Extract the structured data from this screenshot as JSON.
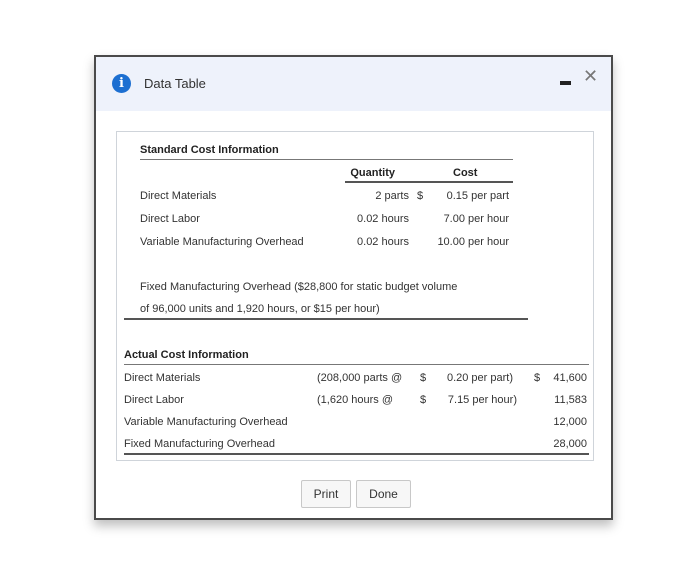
{
  "dialog": {
    "title": "Data Table",
    "info_icon": "i",
    "close_glyph": "✕",
    "buttons": {
      "print": "Print",
      "done": "Done"
    }
  },
  "standard": {
    "heading": "Standard Cost Information",
    "col_quantity": "Quantity",
    "col_cost": "Cost",
    "rows": [
      {
        "label": "Direct Materials",
        "qty": "2 parts",
        "dollar": "$",
        "cost": "0.15 per part"
      },
      {
        "label": "Direct Labor",
        "qty": "0.02 hours",
        "dollar": "",
        "cost": "7.00 per hour"
      },
      {
        "label": "Variable Manufacturing Overhead",
        "qty": "0.02 hours",
        "dollar": "",
        "cost": "10.00 per hour"
      }
    ],
    "fixed_note_line1": "Fixed Manufacturing Overhead ($28,800 for static budget volume",
    "fixed_note_line2": "of 96,000 units and 1,920 hours, or $15 per hour)"
  },
  "actual": {
    "heading": "Actual Cost Information",
    "rows": [
      {
        "label": "Direct Materials",
        "qty": "(208,000 parts @",
        "dollar": "$",
        "rate": "0.20 per part)",
        "total_dollar": "$",
        "total": "41,600"
      },
      {
        "label": "Direct Labor",
        "qty": "(1,620 hours @",
        "dollar": "$",
        "rate": "7.15 per hour)",
        "total_dollar": "",
        "total": "11,583"
      },
      {
        "label": "Variable Manufacturing Overhead",
        "qty": "",
        "dollar": "",
        "rate": "",
        "total_dollar": "",
        "total": "12,000"
      },
      {
        "label": "Fixed Manufacturing Overhead",
        "qty": "",
        "dollar": "",
        "rate": "",
        "total_dollar": "",
        "total": "28,000"
      }
    ]
  }
}
